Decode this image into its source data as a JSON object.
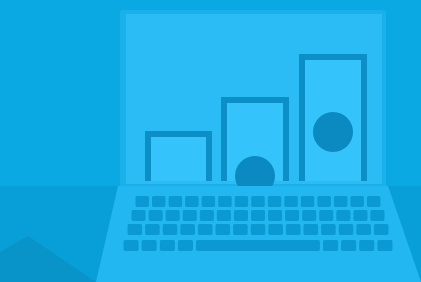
{
  "illustration": {
    "subject": "laptop-with-rising-banknote-stacks",
    "icons": [
      "laptop-icon",
      "banknote-icon",
      "keyboard-icon"
    ],
    "colors": {
      "background": "#0aa9e3",
      "background_dark": "#089fd8",
      "screen": "#2cbcf5",
      "screen_frame": "#1ab0ea",
      "note": "#35c3fb",
      "note_border": "#0b8fc6",
      "note_dark": "#0a8ac1",
      "keyboard_base": "#23b7f1",
      "key": "#0a99d2",
      "shadow": "#0893c9"
    }
  }
}
